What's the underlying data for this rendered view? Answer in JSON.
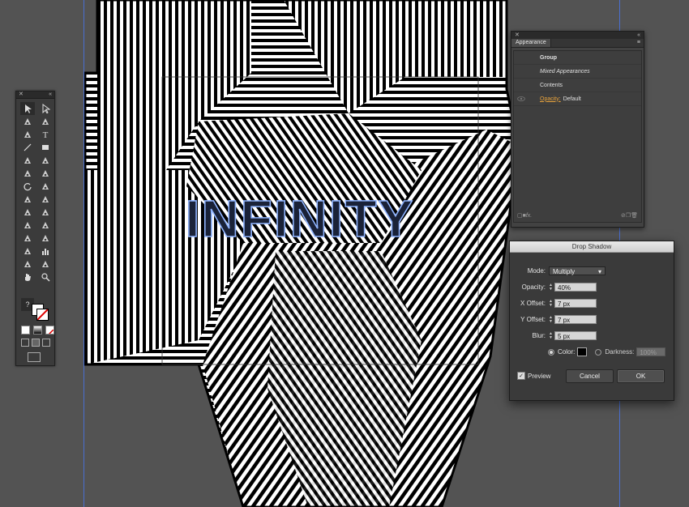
{
  "artwork": {
    "title_text": "INFINITY",
    "title_color": "#1a2238",
    "outline_color": "#8fb4ff",
    "stripe_dark": "#000000",
    "stripe_light": "#ffffff"
  },
  "tools_panel": {
    "icons": [
      "selection-tool-icon",
      "direct-selection-tool-icon",
      "magic-wand-tool-icon",
      "lasso-tool-icon",
      "pen-tool-icon",
      "type-tool-icon",
      "line-tool-icon",
      "rectangle-tool-icon",
      "paintbrush-tool-icon",
      "pencil-tool-icon",
      "blob-brush-tool-icon",
      "eraser-tool-icon",
      "rotate-tool-icon",
      "scale-tool-icon",
      "width-tool-icon",
      "free-transform-tool-icon",
      "shape-builder-tool-icon",
      "perspective-grid-tool-icon",
      "mesh-tool-icon",
      "gradient-tool-icon",
      "eyedropper-tool-icon",
      "blend-tool-icon",
      "symbol-sprayer-tool-icon",
      "column-graph-tool-icon",
      "artboard-tool-icon",
      "slice-tool-icon",
      "hand-tool-icon",
      "zoom-tool-icon"
    ],
    "help_glyph": "?"
  },
  "appearance_panel": {
    "tab": "Appearance",
    "rows": [
      {
        "label": "Group",
        "bold": true
      },
      {
        "label": "Mixed Appearances",
        "italic": true
      },
      {
        "label": "Contents"
      },
      {
        "link": "Opacity:",
        "value": "Default"
      }
    ],
    "footer_fx": "fx."
  },
  "drop_shadow": {
    "title": "Drop Shadow",
    "mode_label": "Mode:",
    "mode_value": "Multiply",
    "opacity_label": "Opacity:",
    "opacity_value": "40%",
    "x_offset_label": "X Offset:",
    "x_offset_value": "7 px",
    "y_offset_label": "Y Offset:",
    "y_offset_value": "7 px",
    "blur_label": "Blur:",
    "blur_value": "5 px",
    "color_label": "Color:",
    "darkness_label": "Darkness:",
    "darkness_value": "100%",
    "preview_label": "Preview",
    "cancel_label": "Cancel",
    "ok_label": "OK"
  }
}
